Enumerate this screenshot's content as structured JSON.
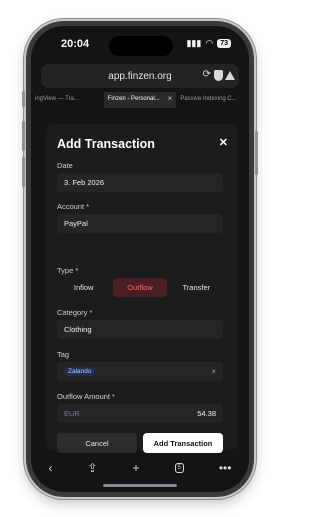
{
  "status": {
    "time": "20:04",
    "battery": "73"
  },
  "browser": {
    "url": "app.finzen.org",
    "tabs": [
      {
        "label": "ingView — Tra..."
      },
      {
        "label": "Finzen - Personal..."
      },
      {
        "label": "Passive Indexing C..."
      }
    ]
  },
  "modal": {
    "title": "Add Transaction",
    "fields": {
      "date": {
        "label": "Date",
        "value": "3. Feb 2026"
      },
      "account": {
        "label": "Account *",
        "value": "PayPal"
      },
      "type": {
        "label": "Type *",
        "options": [
          "Inflow",
          "Outflow",
          "Transfer"
        ],
        "selected": "Outflow"
      },
      "category": {
        "label": "Category *",
        "value": "Clothing"
      },
      "tag": {
        "label": "Tag",
        "chip": "Zalando"
      },
      "amount": {
        "label": "Outflow Amount *",
        "currency": "EUR",
        "value": "54.38"
      }
    },
    "cancel_label": "Cancel",
    "submit_label": "Add Transaction"
  },
  "colors": {
    "accent_outflow": "#ef6a6a",
    "tag_chip": "#1f2f55",
    "primary_button": "#ffffff"
  }
}
